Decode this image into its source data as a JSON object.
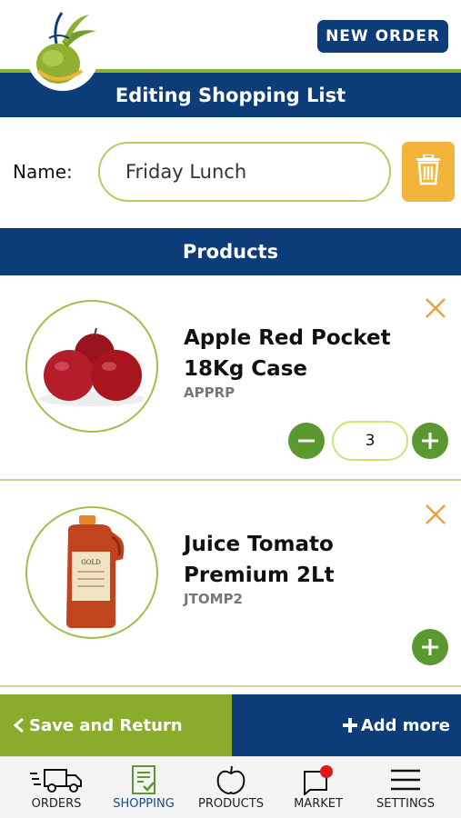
{
  "header": {
    "new_order_label": "NEW ORDER",
    "title": "Editing Shopping List"
  },
  "name_field": {
    "label": "Name:",
    "value": "Friday Lunch"
  },
  "products_section": {
    "title": "Products",
    "items": [
      {
        "name_line1": "Apple Red Pocket",
        "name_line2": "18Kg Case",
        "code": "APPRP",
        "quantity": "3"
      },
      {
        "name_line1": "Juice Tomato",
        "name_line2": "Premium 2Lt",
        "code": "JTOMP2"
      }
    ]
  },
  "actions": {
    "save_label": "Save and Return",
    "add_label": "Add more"
  },
  "tabs": [
    {
      "label": "ORDERS",
      "icon": "truck-icon"
    },
    {
      "label": "SHOPPING",
      "icon": "clipboard-check-icon"
    },
    {
      "label": "PRODUCTS",
      "icon": "apple-icon"
    },
    {
      "label": "MARKET",
      "icon": "market-notification-icon"
    },
    {
      "label": "SETTINGS",
      "icon": "menu-icon"
    }
  ],
  "colors": {
    "brand_navy": "#0d3d78",
    "brand_green": "#8aab2c",
    "button_green": "#5a9830",
    "trash_yellow": "#f2b43a",
    "remove_orange": "#e9a13a"
  }
}
